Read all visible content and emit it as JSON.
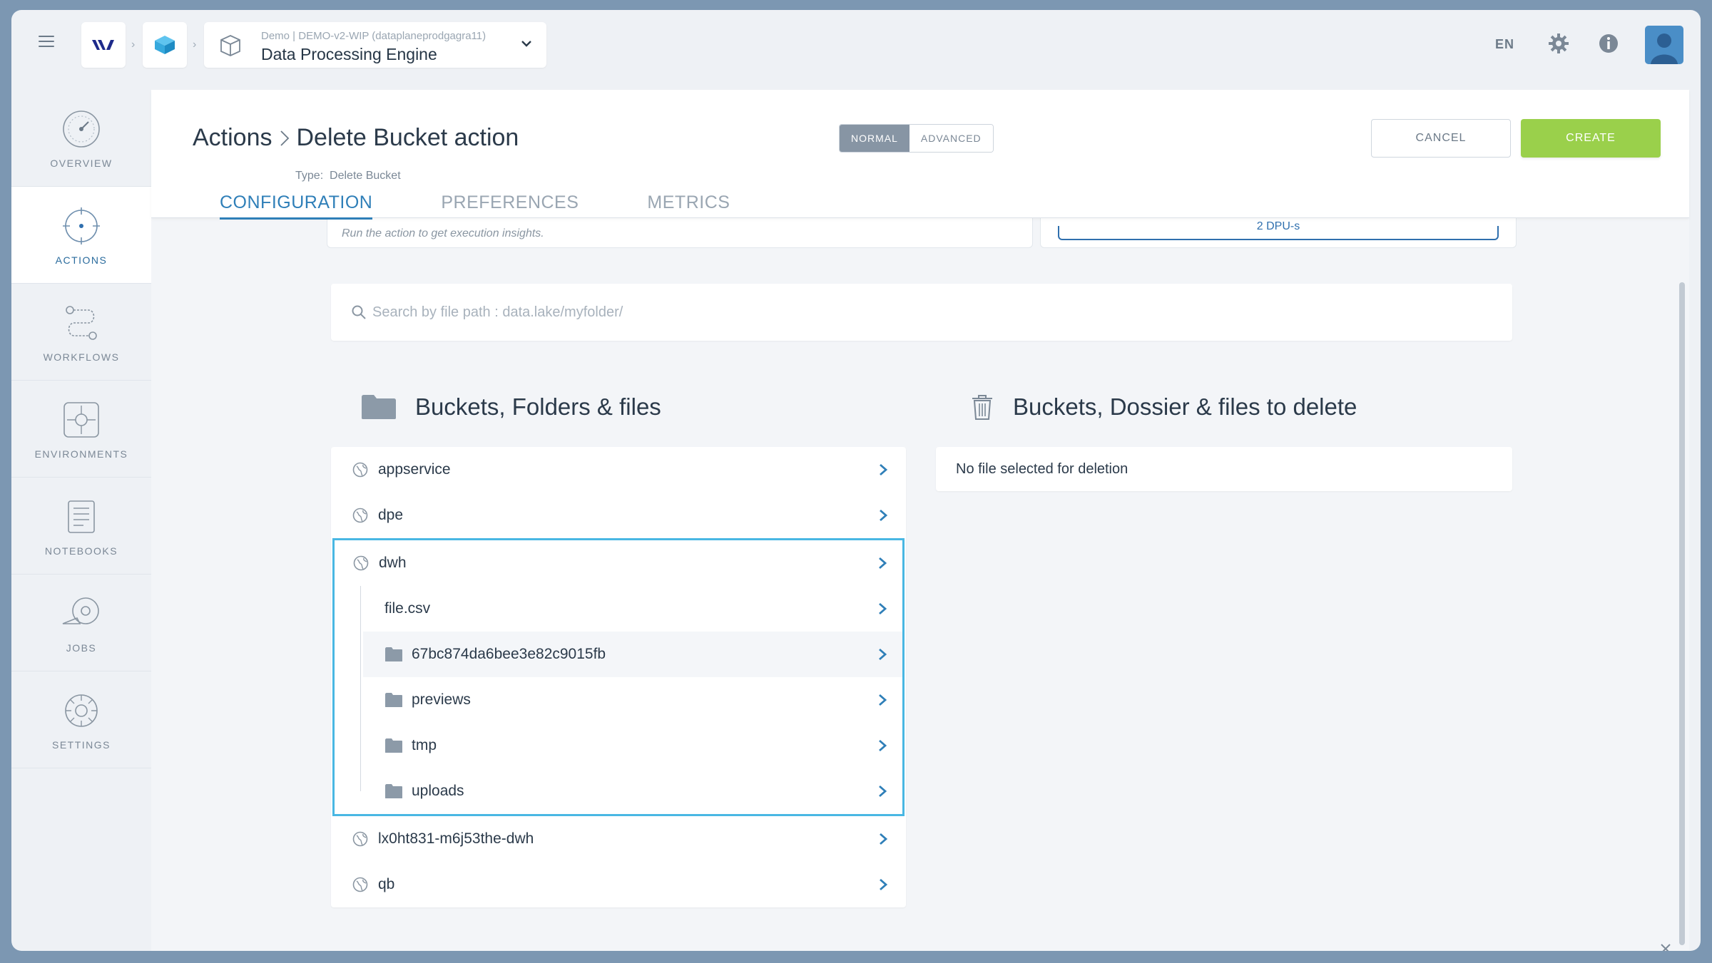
{
  "app": {
    "context_path": "Demo | DEMO-v2-WIP (dataplaneprodgagra11)",
    "context_name": "Data Processing Engine",
    "language": "EN"
  },
  "sidebar": {
    "items": [
      {
        "label": "OVERVIEW",
        "icon": "overview-gauge-icon",
        "active": false
      },
      {
        "label": "ACTIONS",
        "icon": "actions-target-icon",
        "active": true
      },
      {
        "label": "WORKFLOWS",
        "icon": "workflows-icon",
        "active": false
      },
      {
        "label": "ENVIRONMENTS",
        "icon": "environments-icon",
        "active": false
      },
      {
        "label": "NOTEBOOKS",
        "icon": "notebooks-icon",
        "active": false
      },
      {
        "label": "JOBS",
        "icon": "jobs-icon",
        "active": false
      },
      {
        "label": "SETTINGS",
        "icon": "settings-gear-icon",
        "active": false
      }
    ]
  },
  "header": {
    "breadcrumb_parent": "Actions",
    "title": "Delete Bucket action",
    "type_label": "Type:",
    "type_value": "Delete Bucket",
    "mode_normal": "NORMAL",
    "mode_advanced": "ADVANCED",
    "cancel_label": "CANCEL",
    "create_label": "CREATE",
    "tabs": [
      "CONFIGURATION",
      "PREFERENCES",
      "METRICS"
    ]
  },
  "ghost": {
    "left_text": "Run the action to get execution insights.",
    "right_text": "2 DPU-s"
  },
  "search": {
    "placeholder": "Search by file path : data.lake/myfolder/"
  },
  "browser": {
    "title": "Buckets, Folders & files",
    "buckets_before": [
      "appservice",
      "dpe"
    ],
    "expanded_bucket": "dwh",
    "expanded_children": [
      {
        "name": "file.csv",
        "kind": "file"
      },
      {
        "name": "67bc874da6bee3e82c9015fb",
        "kind": "folder"
      },
      {
        "name": "previews",
        "kind": "folder"
      },
      {
        "name": "tmp",
        "kind": "folder"
      },
      {
        "name": "uploads",
        "kind": "folder"
      }
    ],
    "buckets_after": [
      "lx0ht831-m6j53the-dwh",
      "qb"
    ]
  },
  "deletion": {
    "title": "Buckets, Dossier & files to delete",
    "empty_text": "No file selected for deletion"
  },
  "colors": {
    "accent": "#2f7fb8",
    "create_green": "#9ad04b",
    "highlight_border": "#49b7e3",
    "frame": "#7c97b2"
  }
}
